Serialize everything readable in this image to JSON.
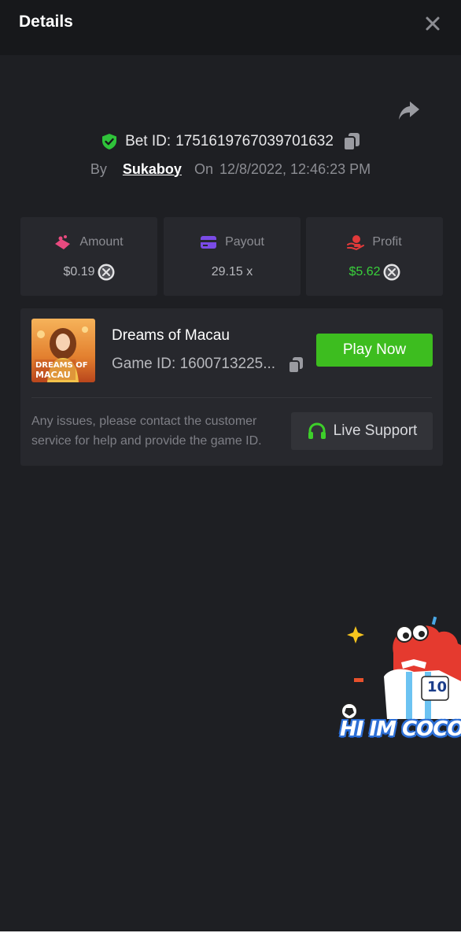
{
  "header": {
    "title": "Details",
    "close_icon": "close-icon"
  },
  "bet": {
    "label_prefix": "Bet ID:",
    "id": "1751619767039701632",
    "by_label": "By",
    "user": "Sukaboy",
    "on_label": "On",
    "datetime": "12/8/2022, 12:46:23 PM"
  },
  "stats": {
    "amount": {
      "label": "Amount",
      "value": "$0.19",
      "icon": "coins-icon"
    },
    "payout": {
      "label": "Payout",
      "value": "29.15 x",
      "icon": "wallet-icon"
    },
    "profit": {
      "label": "Profit",
      "value": "$5.62",
      "icon": "hand-coin-icon"
    }
  },
  "game": {
    "name": "Dreams of Macau",
    "id_label": "Game ID: 1600713225...",
    "thumb_text_line1": "DREAMS OF",
    "thumb_text_line2": "MACAU",
    "play_label": "Play Now",
    "help_text": "Any issues, please contact the customer service for help and provide the game ID.",
    "support_label": "Live Support"
  },
  "mascot": {
    "text": "HI IM COCO",
    "jersey_number": "10"
  },
  "colors": {
    "background": "#1e1f23",
    "card": "#27282d",
    "accent_green": "#3dbd1f",
    "profit_green": "#39d13b",
    "muted": "#8c8d93"
  }
}
